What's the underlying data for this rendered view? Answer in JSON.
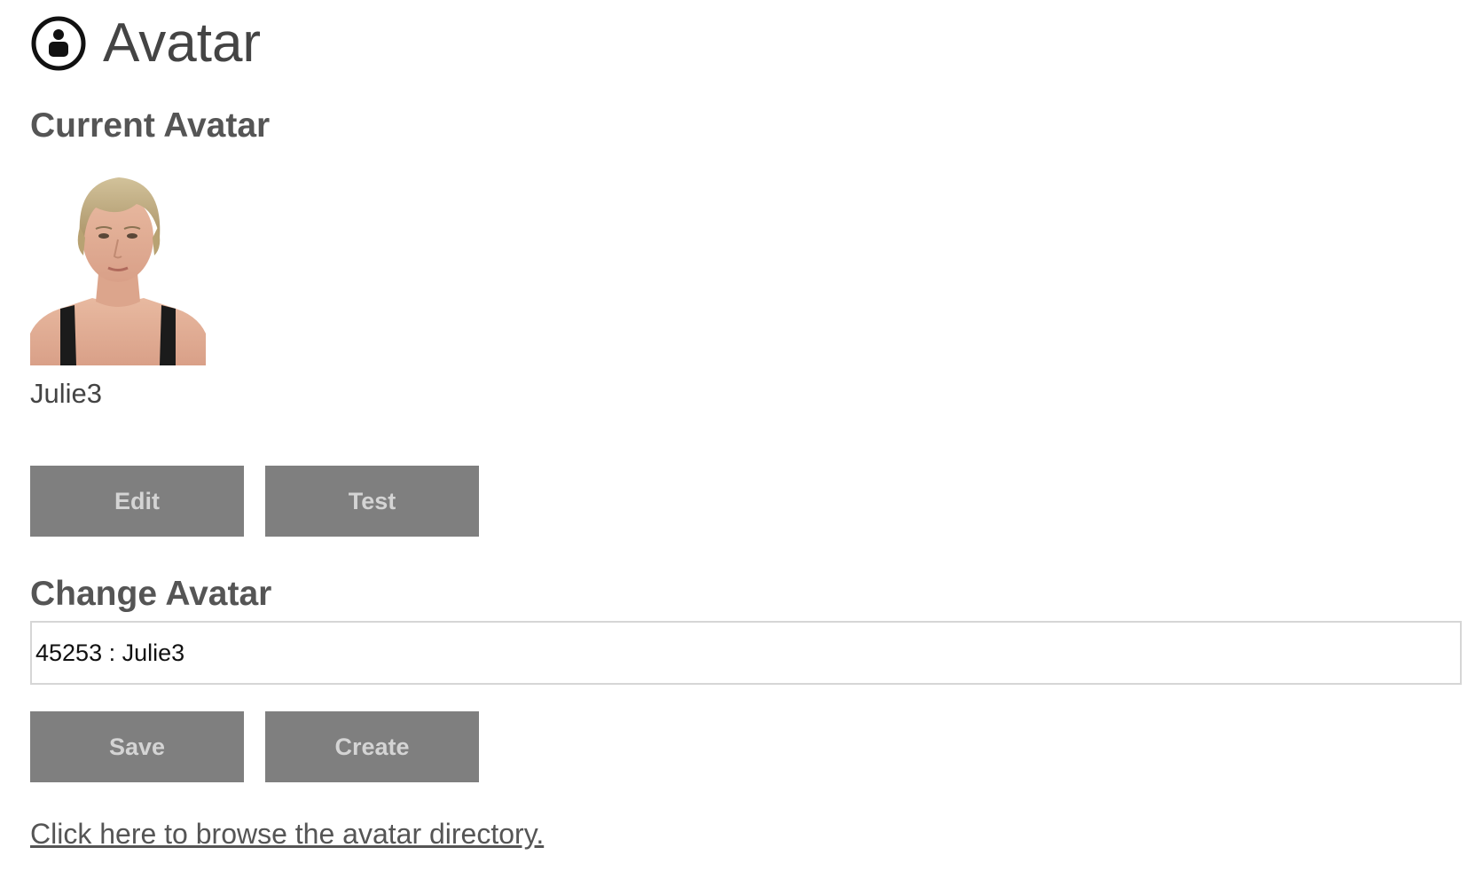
{
  "header": {
    "title": "Avatar",
    "icon": "avatar-circle-icon"
  },
  "current_avatar": {
    "heading": "Current Avatar",
    "name": "Julie3",
    "image": "avatar-portrait-image",
    "buttons": {
      "edit": "Edit",
      "test": "Test"
    }
  },
  "change_avatar": {
    "heading": "Change Avatar",
    "selected_value": "45253 : Julie3",
    "buttons": {
      "save": "Save",
      "create": "Create"
    }
  },
  "links": {
    "browse": "Click here to browse the avatar directory."
  },
  "colors": {
    "button_bg": "#7f7f7f",
    "button_text": "#d4d4d4",
    "text": "#4a4a4a"
  }
}
